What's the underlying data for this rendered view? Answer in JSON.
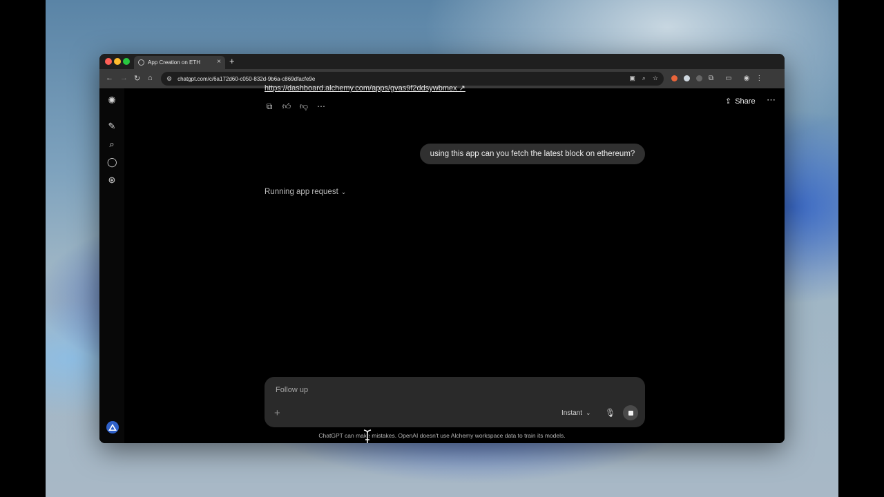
{
  "browser": {
    "tab_title": "App Creation on ETH",
    "url": "chatgpt.com/c/6a172d60-c050-832d-9b6a-c869dfacfe9e"
  },
  "chat": {
    "previous_link": "https://dashboard.alchemy.com/apps/gvas9f2ddsywbmex ↗",
    "user_message": "using this app can you fetch the latest block on ethereum?",
    "status": "Running app request",
    "share_label": "Share"
  },
  "composer": {
    "placeholder": "Follow up",
    "model_label": "Instant"
  },
  "footer": {
    "disclaimer": "ChatGPT can make mistakes. OpenAI doesn't use Alchemy workspace data to train its models."
  },
  "colors": {
    "background": "#000000",
    "user_bubble": "#303030",
    "composer": "#2a2a2a",
    "avatar": "#2f61c9"
  }
}
